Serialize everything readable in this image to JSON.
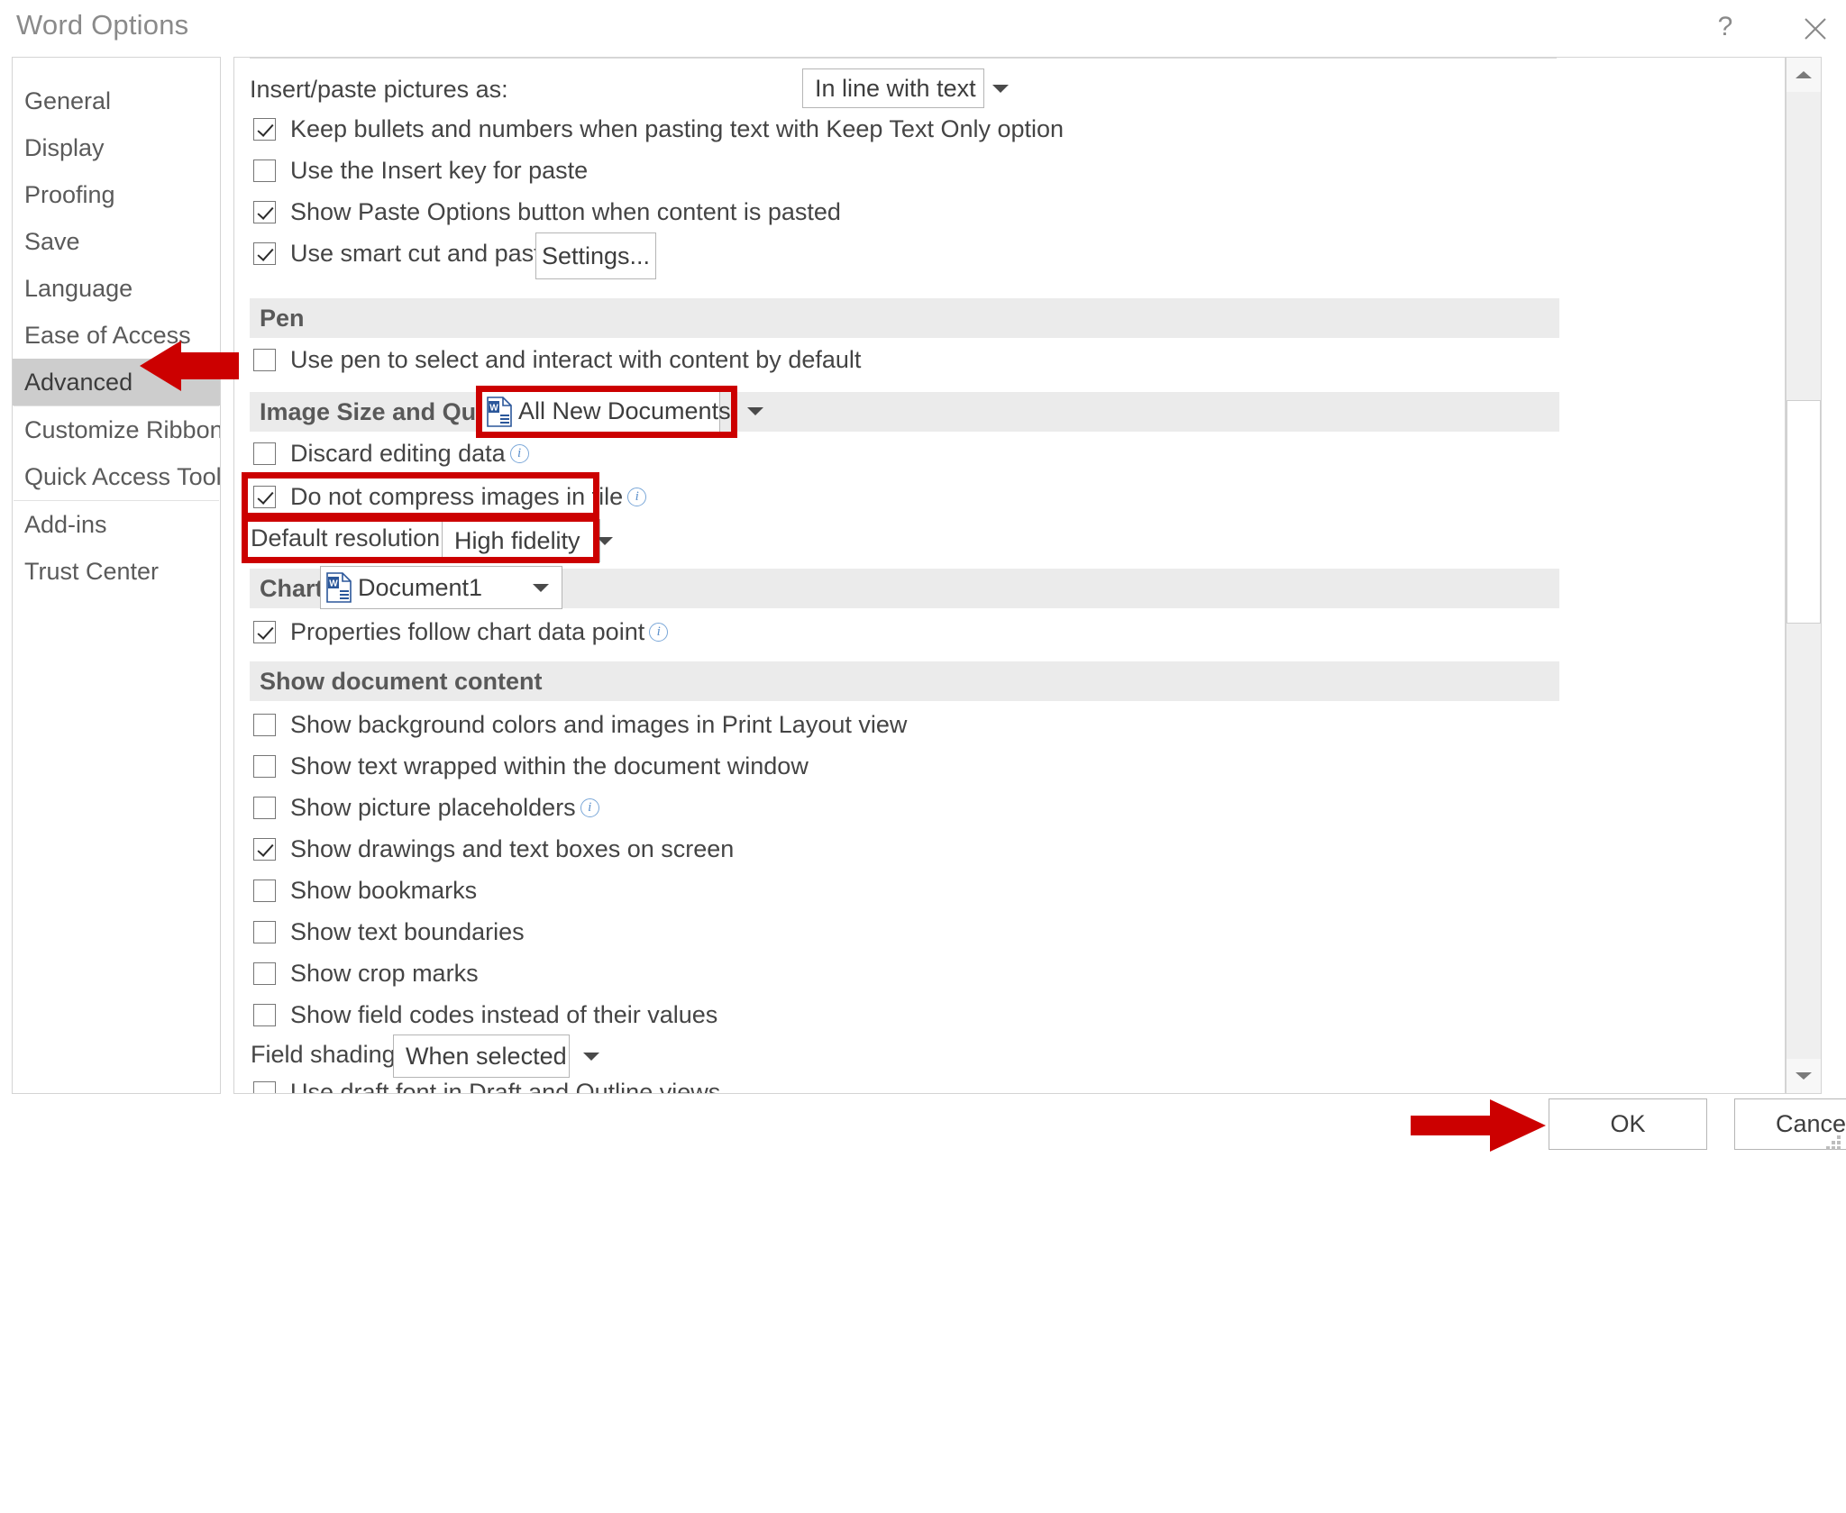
{
  "window": {
    "title": "Word Options",
    "help_icon": "question-mark-icon",
    "close_icon": "close-icon"
  },
  "sidebar": {
    "items": [
      {
        "label": "General",
        "selected": false
      },
      {
        "label": "Display",
        "selected": false
      },
      {
        "label": "Proofing",
        "selected": false
      },
      {
        "label": "Save",
        "selected": false
      },
      {
        "label": "Language",
        "selected": false
      },
      {
        "label": "Ease of Access",
        "selected": false
      },
      {
        "label": "Advanced",
        "selected": true
      },
      {
        "label": "Customize Ribbon",
        "selected": false
      },
      {
        "label": "Quick Access Toolbar",
        "selected": false
      },
      {
        "label": "Add-ins",
        "selected": false
      },
      {
        "label": "Trust Center",
        "selected": false
      }
    ]
  },
  "content": {
    "insert_paste_label": "Insert/paste pictures as:",
    "insert_paste_value": "In line with text",
    "cut_copy_paste": {
      "keep_bullets": {
        "label": "Keep bullets and numbers when pasting text with Keep Text Only option",
        "checked": true
      },
      "insert_key": {
        "label": "Use the Insert key for paste",
        "checked": false
      },
      "show_paste_options": {
        "label": "Show Paste Options button when content is pasted",
        "checked": true
      },
      "smart_cut_paste": {
        "label": "Use smart cut and paste",
        "checked": true
      },
      "settings_button": "Settings..."
    },
    "pen": {
      "title": "Pen",
      "use_pen": {
        "label": "Use pen to select and interact with content by default",
        "checked": false
      }
    },
    "image_size_quality": {
      "title": "Image Size and Quality",
      "scope_value": "All New Documents",
      "discard_editing_data": {
        "label": "Discard editing data",
        "checked": false
      },
      "do_not_compress": {
        "label": "Do not compress images in file",
        "checked": true
      },
      "default_resolution_label": "Default resolution:",
      "default_resolution_value": "High fidelity"
    },
    "chart": {
      "title": "Chart",
      "scope_value": "Document1",
      "properties_follow": {
        "label": "Properties follow chart data point",
        "checked": true
      }
    },
    "show_document_content": {
      "title": "Show document content",
      "options": [
        {
          "label": "Show background colors and images in Print Layout view",
          "checked": false,
          "info": false
        },
        {
          "label": "Show text wrapped within the document window",
          "checked": false,
          "info": false
        },
        {
          "label": "Show picture placeholders",
          "checked": false,
          "info": true
        },
        {
          "label": "Show drawings and text boxes on screen",
          "checked": true,
          "info": false
        },
        {
          "label": "Show bookmarks",
          "checked": false,
          "info": false
        },
        {
          "label": "Show text boundaries",
          "checked": false,
          "info": false
        },
        {
          "label": "Show crop marks",
          "checked": false,
          "info": false
        },
        {
          "label": "Show field codes instead of their values",
          "checked": false,
          "info": false
        }
      ],
      "field_shading_label": "Field shading:",
      "field_shading_value": "When selected",
      "draft_font": {
        "label": "Use draft font in Draft and Outline views",
        "checked": false
      }
    }
  },
  "footer": {
    "ok_label": "OK",
    "cancel_label": "Cancel"
  },
  "annotations": {
    "arrow_color": "#cc0000",
    "highlight_color": "#cc0000",
    "arrow_advanced": "red-arrow-pointing-to-advanced",
    "arrow_ok": "red-arrow-pointing-to-ok"
  },
  "colors": {
    "selected_nav_bg": "#cdcdcd",
    "section_header_bg": "#ebebeb",
    "info_icon": "#5a8fcb",
    "word_icon_blue": "#2b579a"
  }
}
